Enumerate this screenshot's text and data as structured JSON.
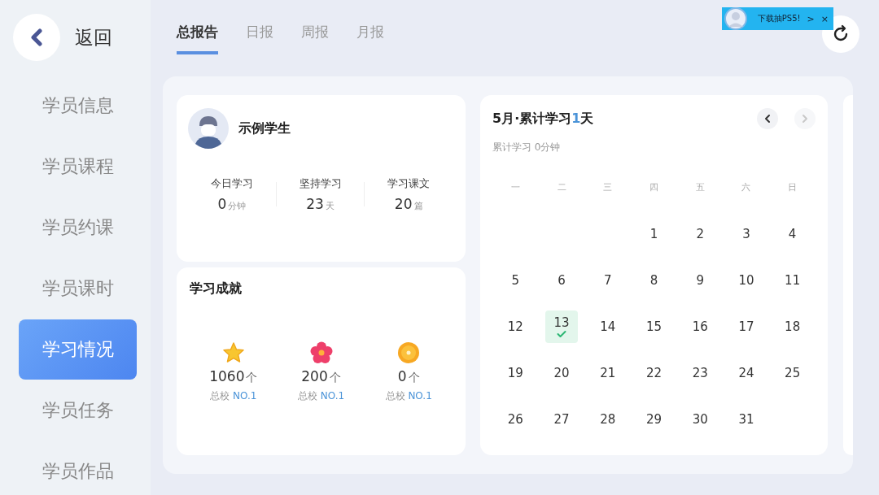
{
  "back": {
    "label": "返回"
  },
  "sidebar": {
    "items": [
      {
        "label": "学员信息",
        "selected": false
      },
      {
        "label": "学员课程",
        "selected": false
      },
      {
        "label": "学员约课",
        "selected": false
      },
      {
        "label": "学员课时",
        "selected": false
      },
      {
        "label": "学习情况",
        "selected": true
      },
      {
        "label": "学员任务",
        "selected": false
      },
      {
        "label": "学员作品",
        "selected": false
      }
    ]
  },
  "tabs": [
    {
      "label": "总报告",
      "selected": true
    },
    {
      "label": "日报",
      "selected": false
    },
    {
      "label": "周报",
      "selected": false
    },
    {
      "label": "月报",
      "selected": false
    }
  ],
  "promo": {
    "text": "下载抽PS5!",
    "more": ">",
    "close": "×"
  },
  "student": {
    "name": "示例学生",
    "stats": [
      {
        "label": "今日学习",
        "value": "0",
        "unit": "分钟"
      },
      {
        "label": "坚持学习",
        "value": "23",
        "unit": "天"
      },
      {
        "label": "学习课文",
        "value": "20",
        "unit": "篇"
      }
    ]
  },
  "achievements": {
    "title": "学习成就",
    "items": [
      {
        "kind": "star",
        "value": "1060",
        "unit": "个",
        "rank_label": "总校",
        "rank": "NO.1"
      },
      {
        "kind": "flower",
        "value": "200",
        "unit": "个",
        "rank_label": "总校",
        "rank": "NO.1"
      },
      {
        "kind": "coin",
        "value": "0",
        "unit": "个",
        "rank_label": "总校",
        "rank": "NO.1"
      }
    ]
  },
  "calendar": {
    "title_before": "5月·累计学习",
    "title_count": "1",
    "title_after": "天",
    "subtitle": "累计学习 0分钟",
    "prev": {
      "disabled": false
    },
    "next": {
      "disabled": true
    },
    "weekdays": [
      "一",
      "二",
      "三",
      "四",
      "五",
      "六",
      "日"
    ],
    "weeks": [
      {
        "kind": "first",
        "days": [
          {
            "day": "1",
            "studied": false
          },
          {
            "day": "2",
            "studied": false
          },
          {
            "day": "3",
            "studied": false
          },
          {
            "day": "4",
            "studied": false
          }
        ]
      },
      {
        "kind": "full",
        "days": [
          {
            "day": "5",
            "studied": false
          },
          {
            "day": "6",
            "studied": false
          },
          {
            "day": "7",
            "studied": false
          },
          {
            "day": "8",
            "studied": false
          },
          {
            "day": "9",
            "studied": false
          },
          {
            "day": "10",
            "studied": false
          },
          {
            "day": "11",
            "studied": false
          }
        ]
      },
      {
        "kind": "full",
        "days": [
          {
            "day": "12",
            "studied": false
          },
          {
            "day": "13",
            "studied": true
          },
          {
            "day": "14",
            "studied": false
          },
          {
            "day": "15",
            "studied": false
          },
          {
            "day": "16",
            "studied": false
          },
          {
            "day": "17",
            "studied": false
          },
          {
            "day": "18",
            "studied": false
          }
        ]
      },
      {
        "kind": "full",
        "days": [
          {
            "day": "19",
            "studied": false
          },
          {
            "day": "20",
            "studied": false
          },
          {
            "day": "21",
            "studied": false
          },
          {
            "day": "22",
            "studied": false
          },
          {
            "day": "23",
            "studied": false
          },
          {
            "day": "24",
            "studied": false
          },
          {
            "day": "25",
            "studied": false
          }
        ]
      },
      {
        "kind": "last",
        "days": [
          {
            "day": "26",
            "studied": false
          },
          {
            "day": "27",
            "studied": false
          },
          {
            "day": "28",
            "studied": false
          },
          {
            "day": "29",
            "studied": false
          },
          {
            "day": "30",
            "studied": false
          },
          {
            "day": "31",
            "studied": false
          }
        ]
      }
    ]
  }
}
